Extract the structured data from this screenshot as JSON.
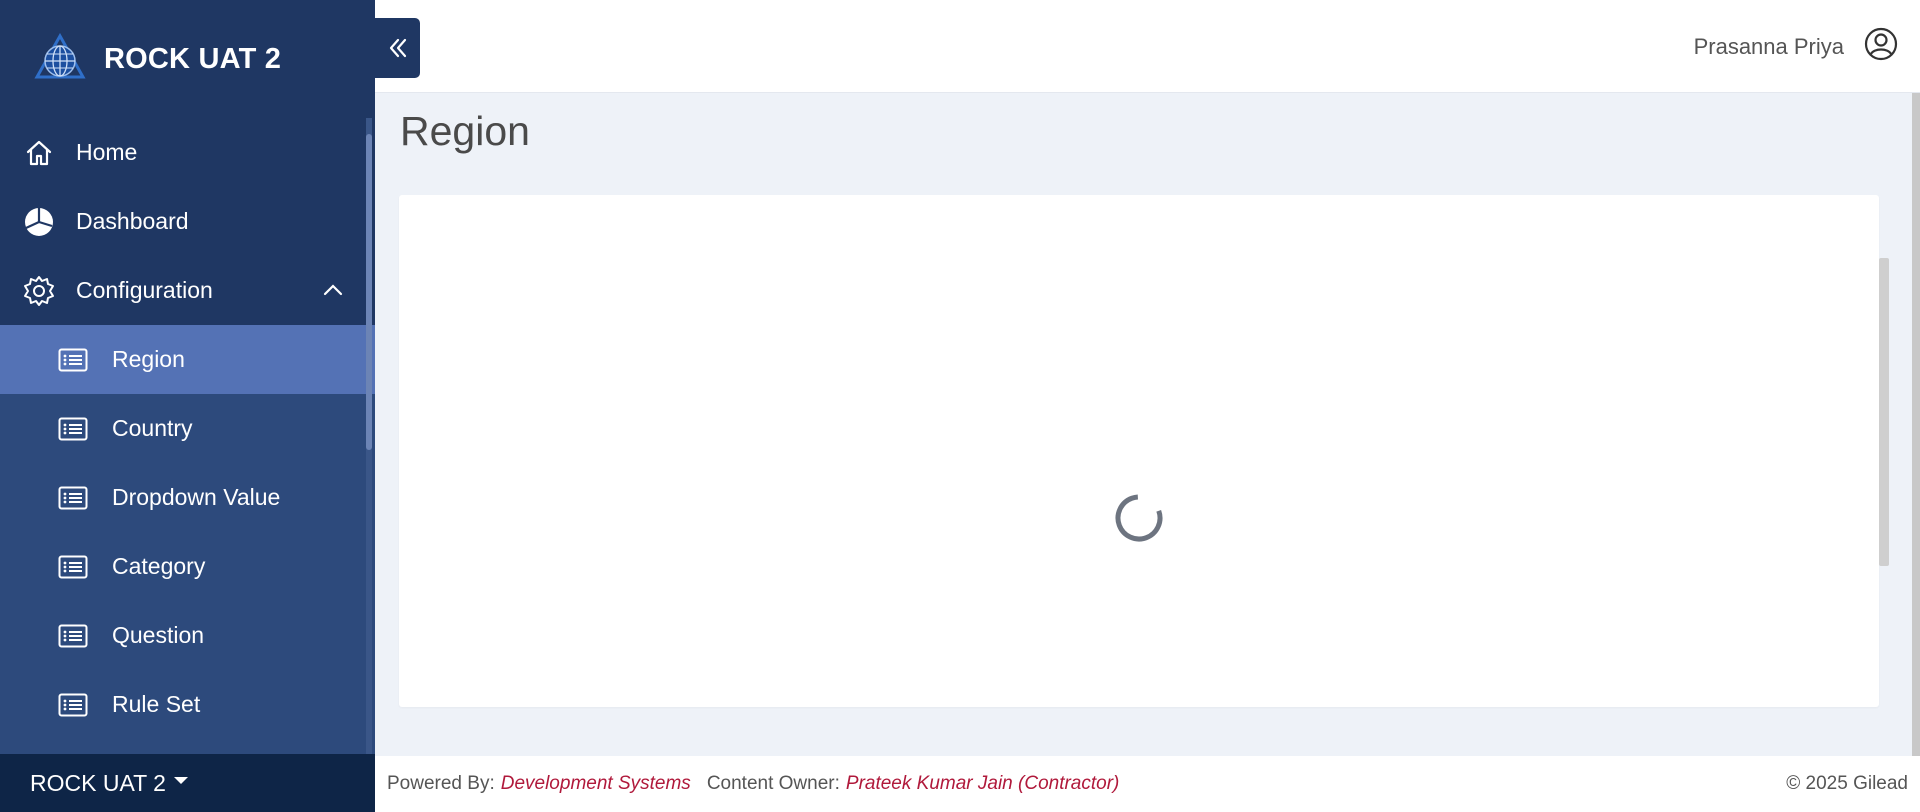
{
  "brand": {
    "title": "ROCK UAT 2",
    "logo_icon": "globe-logo-icon"
  },
  "nav": {
    "top_items": [
      {
        "label": "Home",
        "icon": "home-icon"
      },
      {
        "label": "Dashboard",
        "icon": "pie-chart-icon"
      },
      {
        "label": "Configuration",
        "icon": "gear-icon",
        "expanded": true
      }
    ],
    "sub_items": [
      {
        "label": "Region",
        "icon": "list-icon",
        "active": true
      },
      {
        "label": "Country",
        "icon": "list-icon"
      },
      {
        "label": "Dropdown Value",
        "icon": "list-icon"
      },
      {
        "label": "Category",
        "icon": "list-icon"
      },
      {
        "label": "Question",
        "icon": "list-icon"
      },
      {
        "label": "Rule Set",
        "icon": "list-icon"
      }
    ]
  },
  "env_selector": {
    "label": "ROCK UAT 2"
  },
  "header": {
    "user_name": "Prasanna Priya"
  },
  "main": {
    "page_title": "Region",
    "loading": true
  },
  "footer": {
    "powered_by_label": "Powered By:",
    "powered_by_value": "Development Systems",
    "content_owner_label": "Content Owner:",
    "content_owner_value": "Prateek Kumar Jain (Contractor)",
    "copyright": "© 2025 Gilead"
  },
  "colors": {
    "sidebar_bg": "#2d4a7c",
    "sidebar_top_bg": "#1f3763",
    "active_item": "#5472b5",
    "env_bar_bg": "#0e2547",
    "footer_link": "#b0193b",
    "page_bg": "#eef2f8"
  }
}
